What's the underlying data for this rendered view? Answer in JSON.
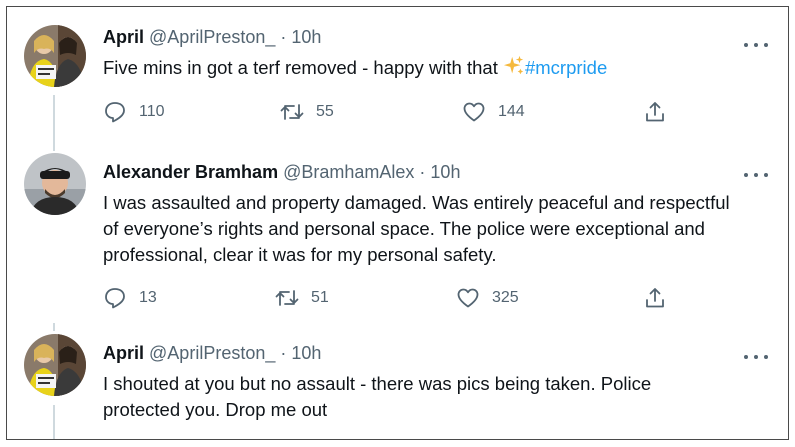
{
  "tweets": [
    {
      "name": "April",
      "handle": "@AprilPreston_",
      "time": "· 10h",
      "text_before": "Five mins in got a terf removed - happy with that ",
      "hashtag": "#mcrpride",
      "replies": "110",
      "retweets": "55",
      "likes": "144"
    },
    {
      "name": "Alexander Bramham",
      "handle": "@BramhamAlex",
      "time": "· 10h",
      "text": "I was assaulted and property damaged. Was entirely peaceful and respectful of everyone’s rights and personal space. The police were exceptional and professional, clear it was for my personal safety.",
      "replies": "13",
      "retweets": "51",
      "likes": "325"
    },
    {
      "name": "April",
      "handle": "@AprilPreston_",
      "time": "· 10h",
      "text": "I shouted at you but no assault - there was pics being taken. Police protected you. Drop me out"
    }
  ],
  "colors": {
    "text": "#0f1419",
    "secondary": "#536471",
    "link": "#1d9bf0",
    "thread_line": "#cfd9de"
  },
  "icons": [
    "reply-icon",
    "retweet-icon",
    "like-icon",
    "share-icon",
    "more-icon",
    "sparkles-icon"
  ]
}
